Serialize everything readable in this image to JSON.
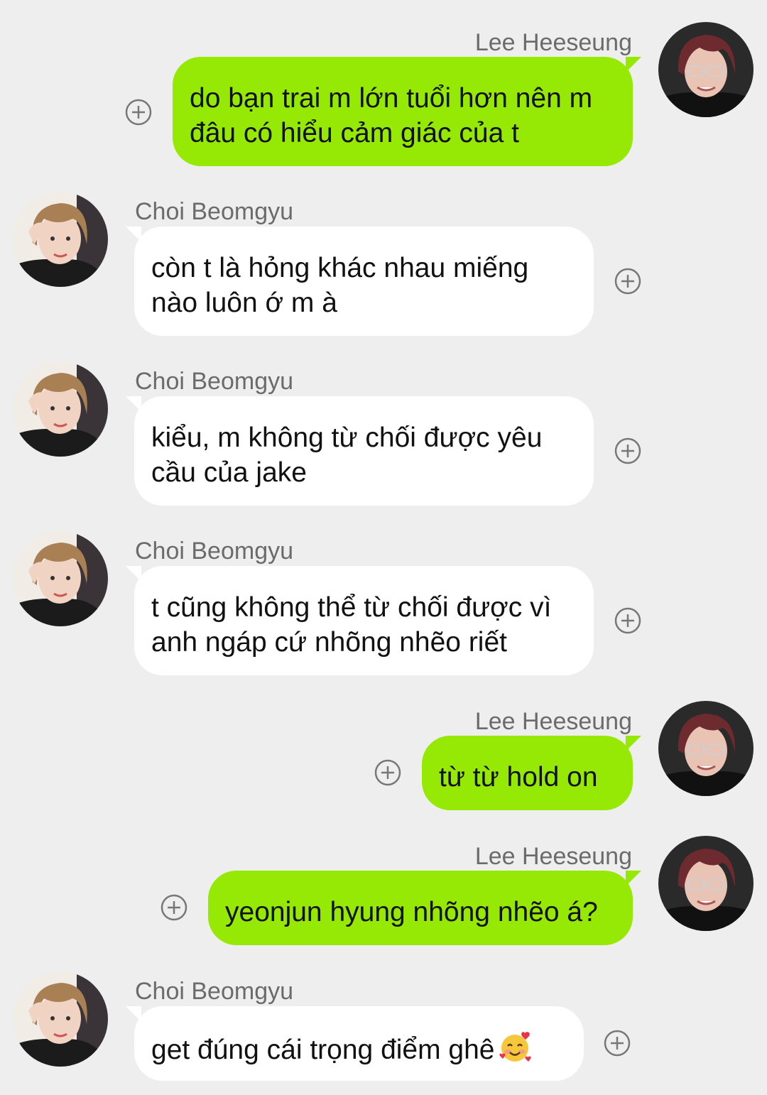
{
  "colors": {
    "background": "#eeeeee",
    "outgoing_bubble": "#96e805",
    "incoming_bubble": "#ffffff",
    "sender_name": "#6b6b6b"
  },
  "messages": [
    {
      "direction": "outgoing",
      "sender": "Lee Heeseung",
      "text": "do bạn trai m lớn tuổi hơn nên m đâu có hiểu cảm giác của t"
    },
    {
      "direction": "incoming",
      "sender": "Choi Beomgyu",
      "text": "còn t là hỏng khác nhau miếng nào luôn ớ m à"
    },
    {
      "direction": "incoming",
      "sender": "Choi Beomgyu",
      "text": "kiểu, m không từ chối được yêu cầu của jake"
    },
    {
      "direction": "incoming",
      "sender": "Choi Beomgyu",
      "text": "t cũng không thể từ chối được vì anh ngáp cứ nhõng nhẽo riết"
    },
    {
      "direction": "outgoing",
      "sender": "Lee Heeseung",
      "text": "từ từ hold on"
    },
    {
      "direction": "outgoing",
      "sender": "Lee Heeseung",
      "text": "yeonjun hyung nhõng nhẽo á?"
    },
    {
      "direction": "incoming",
      "sender": "Choi Beomgyu",
      "text": "get đúng cái trọng điểm ghê",
      "emoji": "smiling-face-with-hearts-emoji"
    }
  ],
  "icons": {
    "add": "circle-plus-icon"
  }
}
